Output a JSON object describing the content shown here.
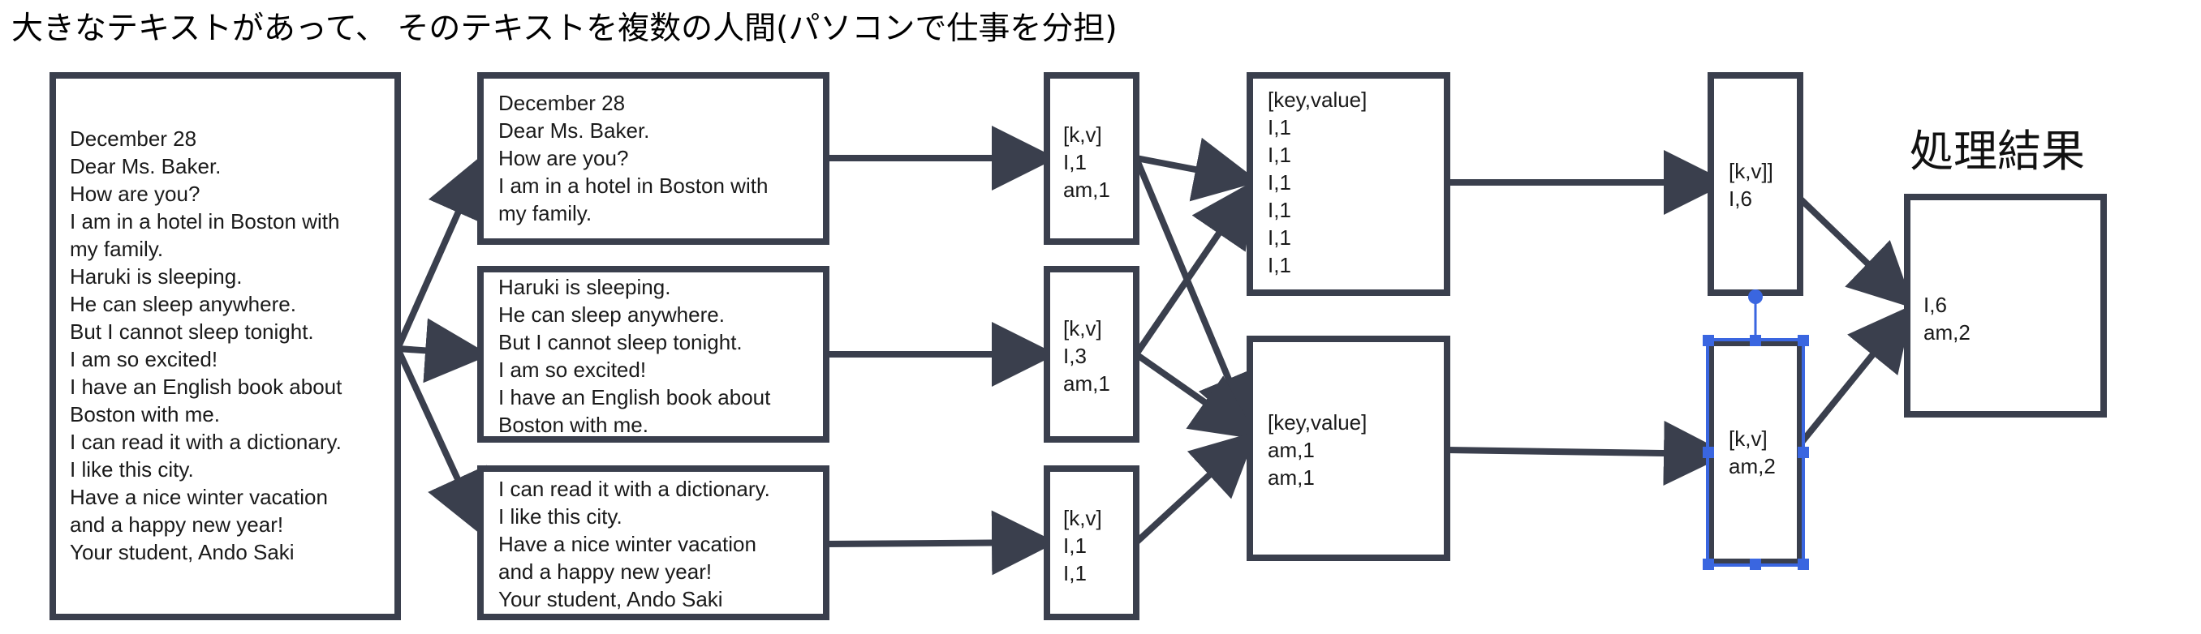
{
  "title": "大きなテキストがあって、 そのテキストを複数の人間(パソコンで仕事を分担)",
  "result_label": "処理結果",
  "colors": {
    "stroke": "#3a3f4d",
    "selection": "#3a66e0",
    "text": "#1a1a1a"
  },
  "boxes": [
    {
      "id": "full-text",
      "lines": [
        "December 28",
        "Dear Ms. Baker.",
        "How are you?",
        "I am in a hotel in Boston with",
        "my family.",
        "Haruki is sleeping.",
        "He can sleep anywhere.",
        "But I cannot sleep tonight.",
        "I am so excited!",
        "I have an English book about",
        "Boston with me.",
        "I can read it with a dictionary.",
        "I like this city.",
        "Have a nice winter vacation",
        "and a happy new year!",
        "Your student, Ando Saki"
      ]
    },
    {
      "id": "split-1",
      "lines": [
        "December 28",
        "Dear Ms. Baker.",
        "How are you?",
        "I am in a hotel in Boston with",
        "my family."
      ]
    },
    {
      "id": "split-2",
      "lines": [
        "Haruki is sleeping.",
        "He can sleep anywhere.",
        "But I cannot sleep tonight.",
        "I am so excited!",
        "I have an English book about",
        "Boston with me."
      ]
    },
    {
      "id": "split-3",
      "lines": [
        "I can read it with a dictionary.",
        "I like this city.",
        "Have a nice winter vacation",
        "and a happy new year!",
        "Your student, Ando Saki"
      ]
    },
    {
      "id": "map-1",
      "lines": [
        "[k,v]",
        "I,1",
        "am,1"
      ]
    },
    {
      "id": "map-2",
      "lines": [
        "[k,v]",
        "I,3",
        "am,1"
      ]
    },
    {
      "id": "map-3",
      "lines": [
        "[k,v]",
        "I,1",
        "I,1"
      ]
    },
    {
      "id": "shuffle-i",
      "lines": [
        "[key,value]",
        "I,1",
        "I,1",
        "I,1",
        "I,1",
        "I,1",
        "I,1"
      ]
    },
    {
      "id": "shuffle-am",
      "lines": [
        "[key,value]",
        "am,1",
        "am,1"
      ]
    },
    {
      "id": "reduce-i",
      "lines": [
        "[k,v]]",
        "I,6"
      ]
    },
    {
      "id": "reduce-am",
      "lines": [
        "[k,v]",
        "am,2"
      ]
    },
    {
      "id": "result",
      "lines": [
        "I,6",
        "am,2"
      ]
    }
  ]
}
